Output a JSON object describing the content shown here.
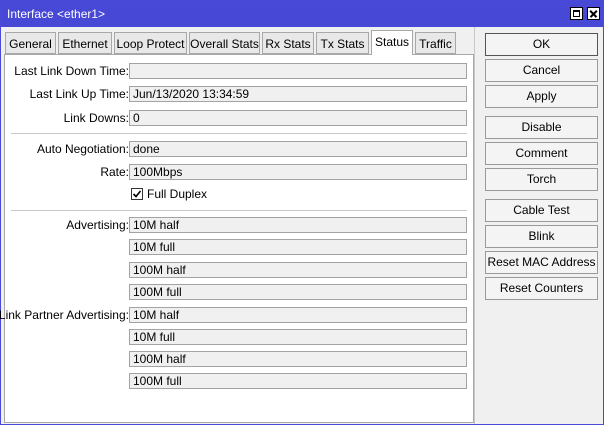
{
  "window": {
    "title": "Interface <ether1>"
  },
  "tabs": [
    {
      "label": "General"
    },
    {
      "label": "Ethernet"
    },
    {
      "label": "Loop Protect"
    },
    {
      "label": "Overall Stats"
    },
    {
      "label": "Rx Stats"
    },
    {
      "label": "Tx Stats"
    },
    {
      "label": "Status",
      "active": true
    },
    {
      "label": "Traffic"
    }
  ],
  "status": {
    "last_link_down_time": {
      "label": "Last Link Down Time:",
      "value": ""
    },
    "last_link_up_time": {
      "label": "Last Link Up Time:",
      "value": "Jun/13/2020 13:34:59"
    },
    "link_downs": {
      "label": "Link Downs:",
      "value": "0"
    },
    "auto_negotiation": {
      "label": "Auto Negotiation:",
      "value": "done"
    },
    "rate": {
      "label": "Rate:",
      "value": "100Mbps"
    },
    "full_duplex": {
      "label": "Full Duplex",
      "checked": true
    },
    "advertising": {
      "label": "Advertising:",
      "values": [
        "10M half",
        "10M full",
        "100M half",
        "100M full"
      ]
    },
    "link_partner_advertising": {
      "label": "Link Partner Advertising:",
      "values": [
        "10M half",
        "10M full",
        "100M half",
        "100M full"
      ]
    }
  },
  "buttons": {
    "ok": "OK",
    "cancel": "Cancel",
    "apply": "Apply",
    "disable": "Disable",
    "comment": "Comment",
    "torch": "Torch",
    "cable_test": "Cable Test",
    "blink": "Blink",
    "reset_mac": "Reset MAC Address",
    "reset_counters": "Reset Counters"
  }
}
